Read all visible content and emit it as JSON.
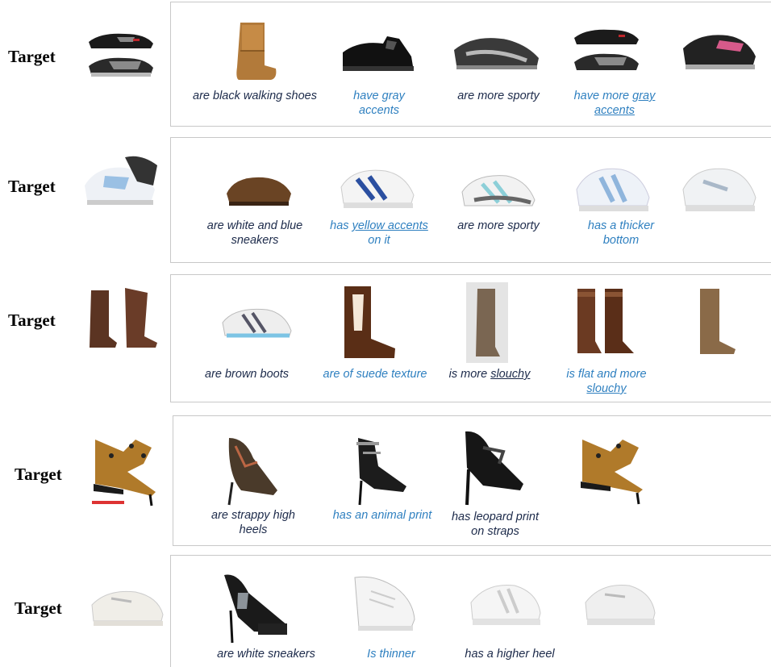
{
  "target_label": "Target",
  "rows": [
    {
      "captions": [
        {
          "parts": [
            {
              "t": "are black walking shoes",
              "u": false
            }
          ],
          "color": "dark"
        },
        {
          "parts": [
            {
              "t": "have gray",
              "u": false
            },
            {
              "t": "accents",
              "u": false
            }
          ],
          "color": "blue",
          "multiline": true
        },
        {
          "parts": [
            {
              "t": "are more sporty",
              "u": false
            }
          ],
          "color": "dark"
        },
        {
          "parts": [
            {
              "t": "have more ",
              "u": false
            },
            {
              "t": "gray",
              "u": true
            },
            {
              "t": "accents",
              "u": true
            }
          ],
          "color": "blue",
          "multiline": true
        }
      ]
    },
    {
      "captions": [
        {
          "parts": [
            {
              "t": "are white and blue",
              "u": false
            },
            {
              "t": "sneakers",
              "u": false
            }
          ],
          "color": "dark",
          "multiline": true
        },
        {
          "parts": [
            {
              "t": "has ",
              "u": false
            },
            {
              "t": "yellow accents",
              "u": true
            },
            {
              "t": "on it",
              "u": false
            }
          ],
          "color": "blue",
          "multiline": true
        },
        {
          "parts": [
            {
              "t": "are more sporty",
              "u": false
            }
          ],
          "color": "dark"
        },
        {
          "parts": [
            {
              "t": "has a thicker",
              "u": false
            },
            {
              "t": "bottom",
              "u": false
            }
          ],
          "color": "blue",
          "multiline": true
        }
      ]
    },
    {
      "captions": [
        {
          "parts": [
            {
              "t": "are brown boots",
              "u": false
            }
          ],
          "color": "dark"
        },
        {
          "parts": [
            {
              "t": "are of suede texture",
              "u": false
            }
          ],
          "color": "blue"
        },
        {
          "parts": [
            {
              "t": "is more ",
              "u": false
            },
            {
              "t": "slouchy",
              "u": true
            }
          ],
          "color": "dark"
        },
        {
          "parts": [
            {
              "t": "is flat and more",
              "u": false
            },
            {
              "t": "slouchy",
              "u": true
            }
          ],
          "color": "blue",
          "multiline": true
        }
      ]
    },
    {
      "captions": [
        {
          "parts": [
            {
              "t": "are strappy high",
              "u": false
            },
            {
              "t": "heels",
              "u": false
            }
          ],
          "color": "dark",
          "multiline": true
        },
        {
          "parts": [
            {
              "t": "has an animal print",
              "u": false
            }
          ],
          "color": "blue"
        },
        {
          "parts": [
            {
              "t": "has leopard print",
              "u": false
            },
            {
              "t": "on straps",
              "u": false
            }
          ],
          "color": "dark",
          "multiline": true
        }
      ]
    },
    {
      "captions": [
        {
          "parts": [
            {
              "t": "are white sneakers",
              "u": false
            }
          ],
          "color": "dark"
        },
        {
          "parts": [
            {
              "t": "Is thinner",
              "u": false
            }
          ],
          "color": "blue"
        },
        {
          "parts": [
            {
              "t": "has a higher heel",
              "u": false
            }
          ],
          "color": "dark"
        }
      ]
    }
  ]
}
